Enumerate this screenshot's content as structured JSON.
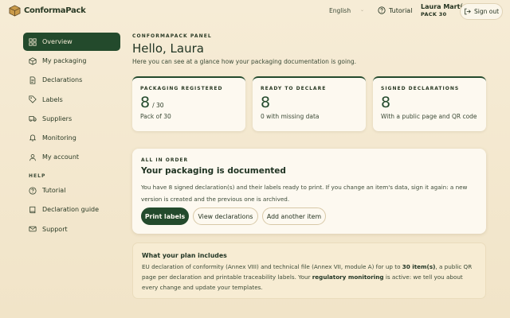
{
  "app": {
    "name": "ConformaPack"
  },
  "header": {
    "language": "English",
    "tutorial_label": "Tutorial",
    "user_name": "Laura Martín",
    "user_pack": "PACK 30",
    "signout_label": "Sign out"
  },
  "sidebar": {
    "items": [
      {
        "label": "Overview",
        "icon": "grid-icon"
      },
      {
        "label": "My packaging",
        "icon": "box-icon"
      },
      {
        "label": "Declarations",
        "icon": "document-icon"
      },
      {
        "label": "Labels",
        "icon": "tag-icon"
      },
      {
        "label": "Suppliers",
        "icon": "truck-icon"
      },
      {
        "label": "Monitoring",
        "icon": "bell-icon"
      },
      {
        "label": "My account",
        "icon": "user-icon"
      }
    ],
    "help_heading": "HELP",
    "help_items": [
      {
        "label": "Tutorial",
        "icon": "help-circle-icon"
      },
      {
        "label": "Declaration guide",
        "icon": "book-icon"
      },
      {
        "label": "Support",
        "icon": "mail-icon"
      }
    ]
  },
  "main": {
    "kicker": "CONFORMAPACK PANEL",
    "title": "Hello, Laura",
    "subtitle": "Here you can see at a glance how your packaging documentation is going.",
    "stats": [
      {
        "label": "PACKAGING REGISTERED",
        "value": "8",
        "of": "/ 30",
        "note": "Pack of 30"
      },
      {
        "label": "READY TO DECLARE",
        "value": "8",
        "of": "",
        "note": "0 with missing data"
      },
      {
        "label": "SIGNED DECLARATIONS",
        "value": "8",
        "of": "",
        "note": "With a public page and QR code"
      }
    ],
    "status_card": {
      "kicker": "ALL IN ORDER",
      "title": "Your packaging is documented",
      "text": "You have 8 signed declaration(s) and their labels ready to print. If you change an item's data, sign it again: a new version is created and the previous one is archived.",
      "buttons": {
        "print": "Print labels",
        "view": "View declarations",
        "add": "Add another item"
      }
    },
    "plan": {
      "title": "What your plan includes",
      "text_1": "EU declaration of conformity (Annex VIII) and technical file (Annex VII, module A) for up to ",
      "text_items": "30 item(s)",
      "text_2": ", a public QR page per declaration and printable traceability labels. Your ",
      "text_monitoring": "regulatory monitoring",
      "text_3": " is active: we tell you about every change and update your templates."
    }
  },
  "colors": {
    "accent": "#234a2c",
    "background": "#f6ecd6",
    "card": "#fdf9f0"
  }
}
